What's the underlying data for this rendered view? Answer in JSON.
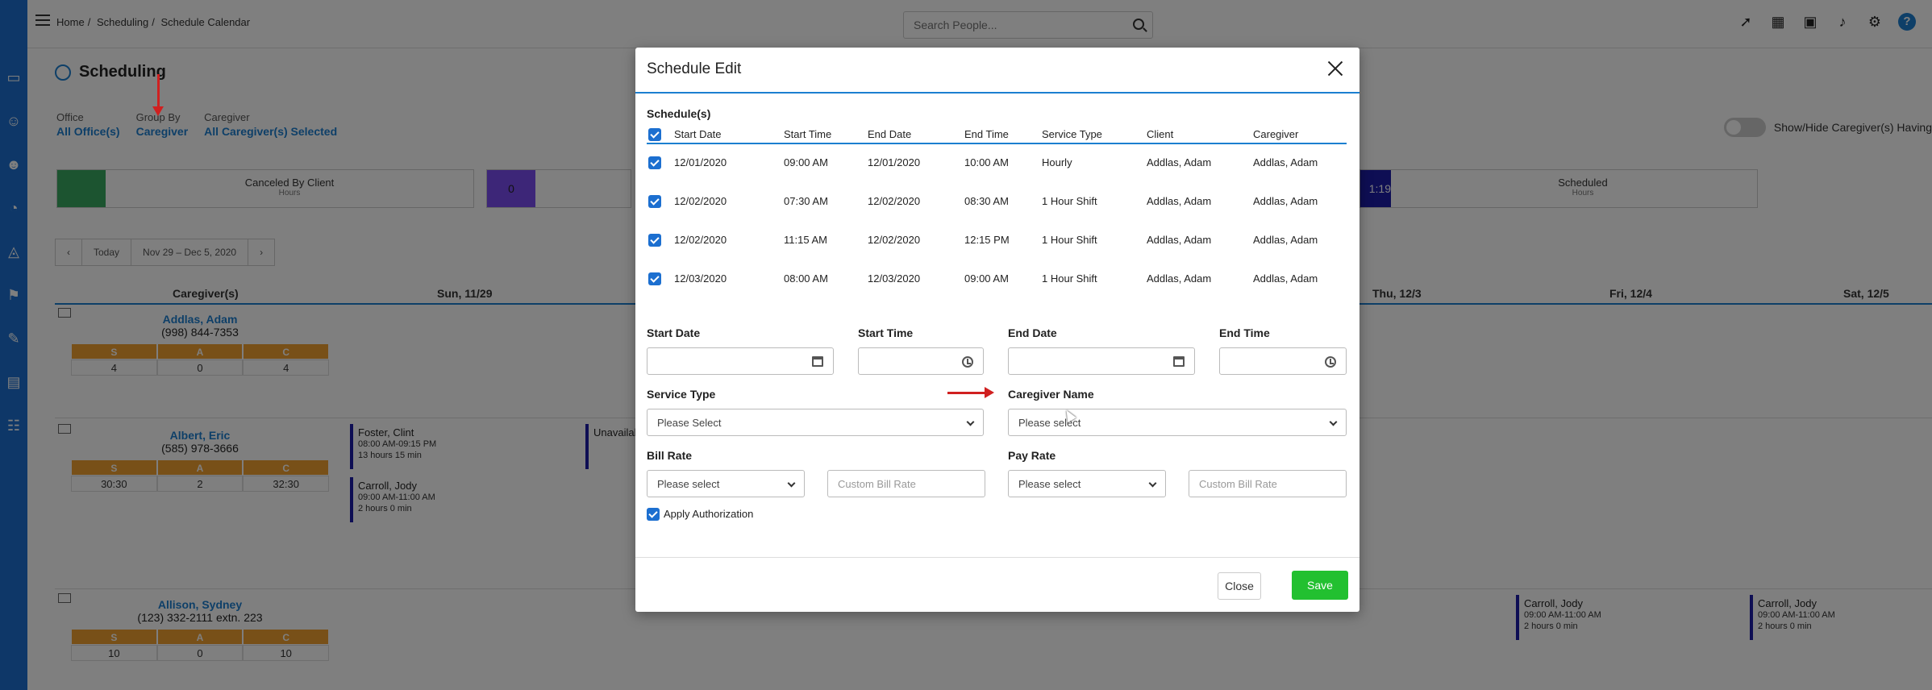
{
  "breadcrumb": [
    "Home",
    "/",
    "Scheduling",
    "/",
    "Schedule Calendar"
  ],
  "search": {
    "placeholder": "Search People..."
  },
  "page_title": "Scheduling",
  "filters": [
    {
      "label": "Office",
      "value": "All Office(s)"
    },
    {
      "label": "Group By",
      "value": "Caregiver"
    },
    {
      "label": "Caregiver",
      "value": "All Caregiver(s) Selected"
    }
  ],
  "toggle_label": "Show/Hide Caregiver(s) Having",
  "stats": [
    {
      "title": "Canceled By Client",
      "sub": "Hours",
      "value": ""
    },
    {
      "title": "",
      "sub": "",
      "value": "0"
    },
    {
      "title": "Scheduled",
      "sub": "Hours",
      "value": "1:19"
    }
  ],
  "week_nav": {
    "today": "Today",
    "range": "Nov 29 – Dec 5, 2020"
  },
  "grid_columns": [
    "Caregiver(s)",
    "Sun, 11/29",
    "Thu, 12/3",
    "Fri, 12/4",
    "Sat, 12/5"
  ],
  "caregivers": [
    {
      "name": "Addlas, Adam",
      "phone": "(998) 844-7353",
      "s": "4",
      "a": "0",
      "c": "4"
    },
    {
      "name": "Albert, Eric",
      "phone": "(585) 978-3666",
      "s": "30:30",
      "a": "2",
      "c": "32:30"
    },
    {
      "name": "Allison, Sydney",
      "phone": "(123) 332-2111 extn. 223",
      "s": "10",
      "a": "0",
      "c": "10"
    }
  ],
  "sac_headers": [
    "S",
    "A",
    "C"
  ],
  "bg_shifts": [
    {
      "name": "Foster, Clint",
      "time": "08:00 AM-09:15 PM",
      "dur": "13 hours 15 min"
    },
    {
      "name": "Carroll, Jody",
      "time": "09:00 AM-11:00 AM",
      "dur": "2 hours 0 min"
    },
    {
      "name": "Unavailable",
      "time": "",
      "dur": ""
    },
    {
      "name": "Carroll, Jody",
      "time": "09:00 AM-11:00 AM",
      "dur": "2 hours 0 min"
    },
    {
      "name": "Carroll, Jody",
      "time": "09:00 AM-11:00 AM",
      "dur": "2 hours 0 min"
    }
  ],
  "modal": {
    "title": "Schedule Edit",
    "schedules_label": "Schedule(s)",
    "columns": [
      "Start Date",
      "Start Time",
      "End Date",
      "End Time",
      "Service Type",
      "Client",
      "Caregiver"
    ],
    "rows": [
      [
        "12/01/2020",
        "09:00 AM",
        "12/01/2020",
        "10:00 AM",
        "Hourly",
        "Addlas, Adam",
        "Addlas, Adam"
      ],
      [
        "12/02/2020",
        "07:30 AM",
        "12/02/2020",
        "08:30 AM",
        "1 Hour Shift",
        "Addlas, Adam",
        "Addlas, Adam"
      ],
      [
        "12/02/2020",
        "11:15 AM",
        "12/02/2020",
        "12:15 PM",
        "1 Hour Shift",
        "Addlas, Adam",
        "Addlas, Adam"
      ],
      [
        "12/03/2020",
        "08:00 AM",
        "12/03/2020",
        "09:00 AM",
        "1 Hour Shift",
        "Addlas, Adam",
        "Addlas, Adam"
      ]
    ],
    "start_date_label": "Start Date",
    "start_time_label": "Start Time",
    "end_date_label": "End Date",
    "end_time_label": "End Time",
    "service_type_label": "Service Type",
    "service_type_value": "Please Select",
    "caregiver_name_label": "Caregiver Name",
    "caregiver_name_value": "Please select",
    "bill_rate_label": "Bill Rate",
    "bill_rate_value": "Please select",
    "custom_bill_rate_placeholder": "Custom Bill Rate",
    "pay_rate_label": "Pay Rate",
    "pay_rate_value": "Please select",
    "custom_pay_rate_placeholder": "Custom Bill Rate",
    "apply_authorization_label": "Apply Authorization",
    "close_label": "Close",
    "save_label": "Save"
  },
  "colors": {
    "accent": "#1c7fd0",
    "save": "#22c030",
    "annotation_arrow": "#d02020",
    "sac_header": "#f0a030"
  }
}
